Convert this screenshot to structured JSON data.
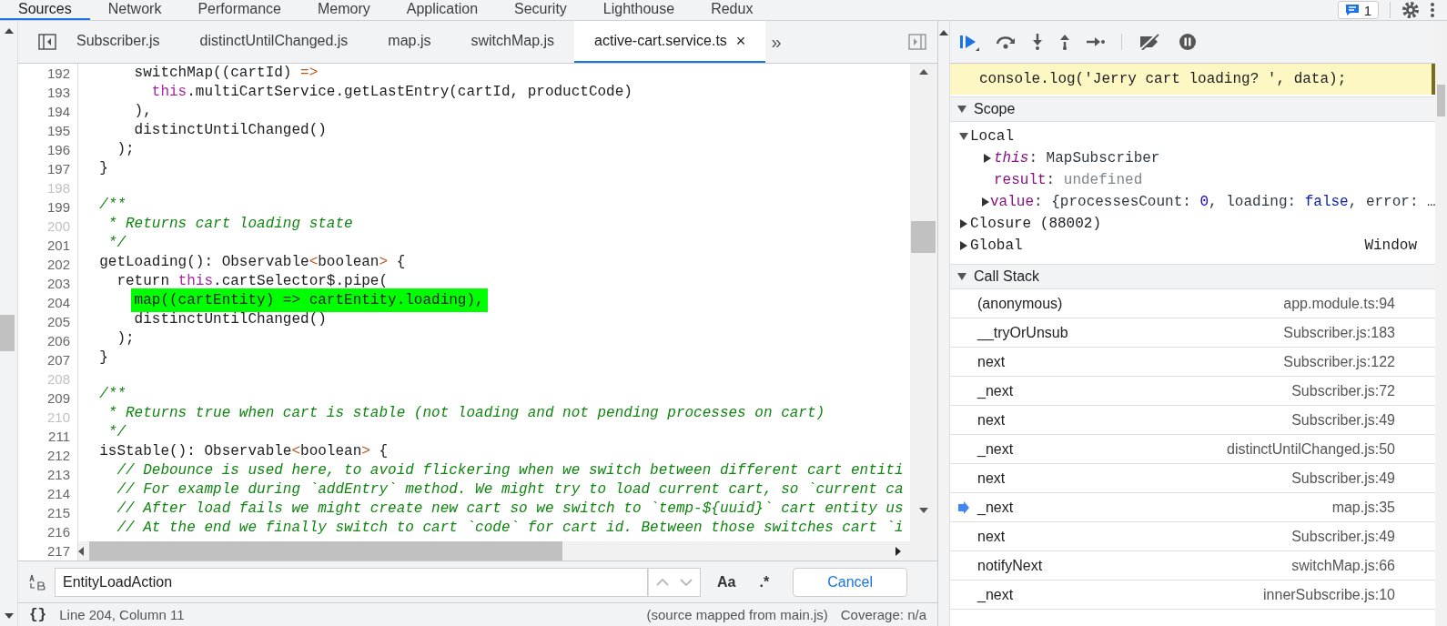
{
  "top_tabs": [
    {
      "label": "Sources",
      "selected": true
    },
    {
      "label": "Network",
      "selected": false
    },
    {
      "label": "Performance",
      "selected": false
    },
    {
      "label": "Memory",
      "selected": false
    },
    {
      "label": "Application",
      "selected": false
    },
    {
      "label": "Security",
      "selected": false
    },
    {
      "label": "Lighthouse",
      "selected": false
    },
    {
      "label": "Redux",
      "selected": false
    }
  ],
  "issues_count": "1",
  "file_tabs": [
    {
      "label": "Subscriber.js",
      "selected": false
    },
    {
      "label": "distinctUntilChanged.js",
      "selected": false
    },
    {
      "label": "map.js",
      "selected": false
    },
    {
      "label": "switchMap.js",
      "selected": false
    },
    {
      "label": "active-cart.service.ts",
      "selected": true,
      "close": "×"
    }
  ],
  "more_tabs": "»",
  "code": {
    "lines": [
      {
        "number": "192",
        "mapped": true,
        "segments": [
          {
            "text": "      switchMap((cartId) ",
            "kind": "plain"
          },
          {
            "text": "=>",
            "kind": "op"
          }
        ]
      },
      {
        "number": "193",
        "mapped": true,
        "segments": [
          {
            "text": "        this",
            "kind": "keyword"
          },
          {
            "text": ".multiCartService.getLastEntry(cartId, productCode)",
            "kind": "plain"
          }
        ]
      },
      {
        "number": "194",
        "mapped": true,
        "segments": [
          {
            "text": "      ),",
            "kind": "plain"
          }
        ]
      },
      {
        "number": "195",
        "mapped": true,
        "segments": [
          {
            "text": "      distinctUntilChanged()",
            "kind": "plain"
          }
        ]
      },
      {
        "number": "196",
        "mapped": true,
        "segments": [
          {
            "text": "    );",
            "kind": "plain"
          }
        ]
      },
      {
        "number": "197",
        "mapped": true,
        "segments": [
          {
            "text": "  }",
            "kind": "plain"
          }
        ]
      },
      {
        "number": "198",
        "mapped": false
      },
      {
        "number": "199",
        "mapped": true,
        "segments": [
          {
            "text": "  /**",
            "kind": "comment"
          }
        ]
      },
      {
        "number": "200",
        "mapped": false,
        "segments": [
          {
            "text": "   * Returns cart loading state",
            "kind": "comment"
          }
        ]
      },
      {
        "number": "201",
        "mapped": true,
        "segments": [
          {
            "text": "   */",
            "kind": "comment"
          }
        ]
      },
      {
        "number": "202",
        "mapped": true,
        "segments": [
          {
            "text": "  getLoading(): Observable",
            "kind": "plain"
          },
          {
            "text": "<",
            "kind": "op"
          },
          {
            "text": "boolean",
            "kind": "plain"
          },
          {
            "text": ">",
            "kind": "op"
          },
          {
            "text": " {",
            "kind": "plain"
          }
        ]
      },
      {
        "number": "203",
        "mapped": true,
        "segments": [
          {
            "text": "    return ",
            "kind": "plain"
          },
          {
            "text": "this",
            "kind": "keyword"
          },
          {
            "text": ".cartSelector$.pipe(",
            "kind": "plain"
          }
        ]
      },
      {
        "number": "204",
        "mapped": true,
        "segments": [
          {
            "text": "      map((cartEntity) => cartEntity.loading),",
            "kind": "match"
          }
        ]
      },
      {
        "number": "205",
        "mapped": true,
        "segments": [
          {
            "text": "      distinctUntilChanged()",
            "kind": "plain"
          }
        ]
      },
      {
        "number": "206",
        "mapped": true,
        "segments": [
          {
            "text": "    );",
            "kind": "plain"
          }
        ]
      },
      {
        "number": "207",
        "mapped": true,
        "segments": [
          {
            "text": "  }",
            "kind": "plain"
          }
        ]
      },
      {
        "number": "208",
        "mapped": false
      },
      {
        "number": "209",
        "mapped": true,
        "segments": [
          {
            "text": "  /**",
            "kind": "comment"
          }
        ]
      },
      {
        "number": "210",
        "mapped": false,
        "segments": [
          {
            "text": "   * Returns true when cart is stable (not loading and not pending processes on cart)",
            "kind": "comment"
          }
        ]
      },
      {
        "number": "211",
        "mapped": true,
        "segments": [
          {
            "text": "   */",
            "kind": "comment"
          }
        ]
      },
      {
        "number": "212",
        "mapped": true,
        "segments": [
          {
            "text": "  isStable(): Observable",
            "kind": "plain"
          },
          {
            "text": "<",
            "kind": "op"
          },
          {
            "text": "boolean",
            "kind": "plain"
          },
          {
            "text": ">",
            "kind": "op"
          },
          {
            "text": " {",
            "kind": "plain"
          }
        ]
      },
      {
        "number": "213",
        "mapped": true,
        "segments": [
          {
            "text": "    // Debounce is used here, to avoid flickering when we switch between different cart entiti",
            "kind": "comment"
          }
        ]
      },
      {
        "number": "214",
        "mapped": true,
        "segments": [
          {
            "text": "    // For example during `addEntry` method. We might try to load current cart, so `current ca",
            "kind": "comment"
          }
        ]
      },
      {
        "number": "215",
        "mapped": true,
        "segments": [
          {
            "text": "    // After load fails we might create new cart so we switch to `temp-${uuid}` cart entity us",
            "kind": "comment"
          }
        ]
      },
      {
        "number": "216",
        "mapped": true,
        "segments": [
          {
            "text": "    // At the end we finally switch to cart `code` for cart id. Between those switches cart `i",
            "kind": "comment"
          }
        ]
      }
    ],
    "scrollbar_line_number": "217"
  },
  "search": {
    "value": "EntityLoadAction",
    "case_button": "Aa",
    "regex_button": ".*",
    "cancel": "Cancel"
  },
  "status_bar": {
    "format_button": "{}",
    "position": "Line 204, Column 11",
    "source_map": "(source mapped from main.js)",
    "coverage": "Coverage: n/a"
  },
  "breakpoint_snippet": "console.log('Jerry cart loading? ', data);",
  "scope": {
    "title": "Scope",
    "expanded": true,
    "items": [
      {
        "kind": "group",
        "label": "Local",
        "expanded": true,
        "children": [
          {
            "kind": "receiver",
            "label": "this",
            "expanded": false,
            "value": [
              {
                "text": ": MapSubscriber",
                "kind": "plain"
              }
            ]
          },
          {
            "kind": "property",
            "label": "result",
            "value": [
              {
                "text": ": ",
                "kind": "plain"
              },
              {
                "text": "undefined",
                "kind": "muted"
              }
            ]
          },
          {
            "kind": "property",
            "label": "value",
            "expanded": false,
            "value": [
              {
                "text": ": {processesCount: ",
                "kind": "plain"
              },
              {
                "text": "0",
                "kind": "number"
              },
              {
                "text": ", loading: ",
                "kind": "plain"
              },
              {
                "text": "false",
                "kind": "keyword"
              },
              {
                "text": ", error: …",
                "kind": "plain"
              }
            ]
          }
        ]
      },
      {
        "kind": "group",
        "label": "Closure (88002)",
        "expanded": false
      },
      {
        "kind": "group",
        "label": "Global",
        "expanded": false,
        "note": "Window"
      }
    ]
  },
  "call_stack": {
    "title": "Call Stack",
    "expanded": true,
    "frames": [
      {
        "function": "(anonymous)",
        "location": "app.module.ts:94",
        "selected": false
      },
      {
        "function": "__tryOrUnsub",
        "location": "Subscriber.js:183",
        "selected": false
      },
      {
        "function": "next",
        "location": "Subscriber.js:122",
        "selected": false
      },
      {
        "function": "_next",
        "location": "Subscriber.js:72",
        "selected": false
      },
      {
        "function": "next",
        "location": "Subscriber.js:49",
        "selected": false
      },
      {
        "function": "_next",
        "location": "distinctUntilChanged.js:50",
        "selected": false
      },
      {
        "function": "next",
        "location": "Subscriber.js:49",
        "selected": false
      },
      {
        "function": "_next",
        "location": "map.js:35",
        "selected": true
      },
      {
        "function": "next",
        "location": "Subscriber.js:49",
        "selected": false
      },
      {
        "function": "notifyNext",
        "location": "switchMap.js:66",
        "selected": false
      },
      {
        "function": "_next",
        "location": "innerSubscribe.js:10",
        "selected": false
      }
    ]
  }
}
